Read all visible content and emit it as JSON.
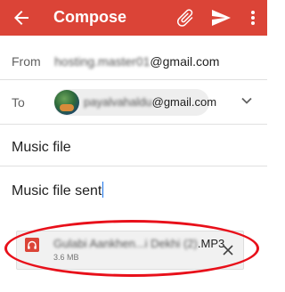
{
  "app_bar": {
    "title": "Compose",
    "back_icon": "arrow-back-icon",
    "attach_icon": "paperclip-icon",
    "send_icon": "send-icon",
    "more_icon": "more-vert-icon",
    "color": "#db4437"
  },
  "from": {
    "label": "From",
    "value_blurred": "hosting.master01",
    "value_suffix": "@gmail.com"
  },
  "to": {
    "label": "To",
    "recipient_blurred": "payalvahaldu",
    "recipient_suffix": "@gmail.com",
    "expand_icon": "chevron-down-icon"
  },
  "subject": "Music file",
  "body": "Music file sent",
  "attachment": {
    "name_blurred": "Gulabi Aankhen...i Dekhi (2)",
    "name_suffix": ".MP3",
    "size": "3.6 MB",
    "icon": "headphones-icon",
    "remove_icon": "close-icon"
  },
  "annotation_color": "#e8101a"
}
